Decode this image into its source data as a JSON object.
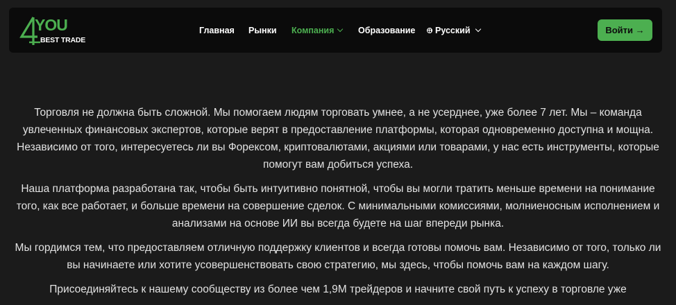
{
  "brand": {
    "logo_main": "YOU",
    "logo_sub": "BEST TRADE",
    "primary_color": "#4caf50"
  },
  "nav": {
    "items": [
      {
        "label": "Главная",
        "active": false
      },
      {
        "label": "Рынки",
        "active": false
      },
      {
        "label": "Компания",
        "active": true,
        "has_dropdown": true
      },
      {
        "label": "Образование",
        "active": false
      }
    ],
    "language": {
      "label": "Русский",
      "icon": "globe-icon"
    },
    "login_label": "Войти →"
  },
  "content": {
    "paragraphs": [
      "Торговля не должна быть сложной. Мы помогаем людям торговать умнее, а не усерднее, уже более 7 лет. Мы – команда увлеченных финансовых экспертов, которые верят в предоставление платформы, которая одновременно доступна и мощна. Независимо от того, интересуетесь ли вы Форексом, криптовалютами, акциями или товарами, у нас есть инструменты, которые помогут вам добиться успеха.",
      "Наша платформа разработана так, чтобы быть интуитивно понятной, чтобы вы могли тратить меньше времени на понимание того, как все работает, и больше времени на совершение сделок. С минимальными комиссиями, молниеносным исполнением и анализами на основе ИИ вы всегда будете на шаг впереди рынка.",
      "Мы гордимся тем, что предоставляем отличную поддержку клиентов и всегда готовы помочь вам. Независимо от того, только ли вы начинаете или хотите усовершенствовать свою стратегию, мы здесь, чтобы помочь вам на каждом шагу.",
      "Присоединяйтесь к нашему сообществу из более чем 1,9М трейдеров и начните свой путь к успеху в торговле уже"
    ]
  }
}
